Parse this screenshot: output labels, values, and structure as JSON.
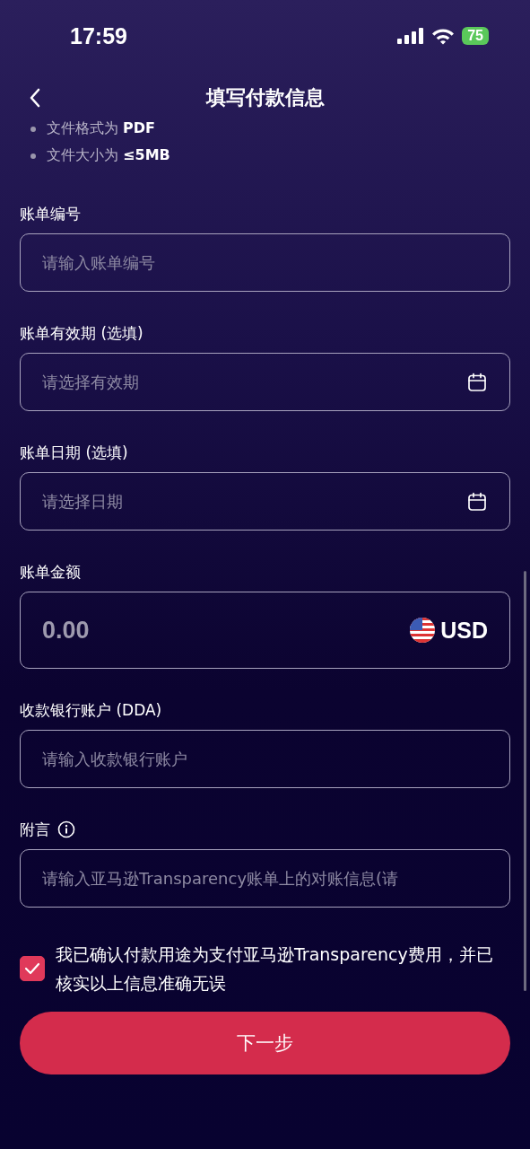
{
  "status_bar": {
    "time": "17:59",
    "battery": "75"
  },
  "header": {
    "title": "填写付款信息"
  },
  "requirements": [
    "文件格式为 **PDF**",
    "文件大小为 **≤5MB**"
  ],
  "fields": [
    {
      "kind": "text",
      "label": "账单编号",
      "placeholder": "请输入账单编号"
    },
    {
      "kind": "date",
      "label": "账单有效期 (选填)",
      "placeholder": "请选择有效期"
    },
    {
      "kind": "date",
      "label": "账单日期 (选填)",
      "placeholder": "请选择日期"
    },
    {
      "kind": "amount",
      "label": "账单金额",
      "placeholder": "0.00",
      "currency": "USD"
    },
    {
      "kind": "text",
      "label": "收款银行账户 (DDA)",
      "placeholder": "请输入收款银行账户"
    },
    {
      "kind": "note",
      "label": "附言",
      "placeholder": "请输入亚马逊Transparency账单上的对账信息(请"
    }
  ],
  "confirm": {
    "checked": true,
    "text": "我已确认付款用途为支付亚马逊Transparency费用，并已核实以上信息准确无误"
  },
  "next_button": "下一步"
}
